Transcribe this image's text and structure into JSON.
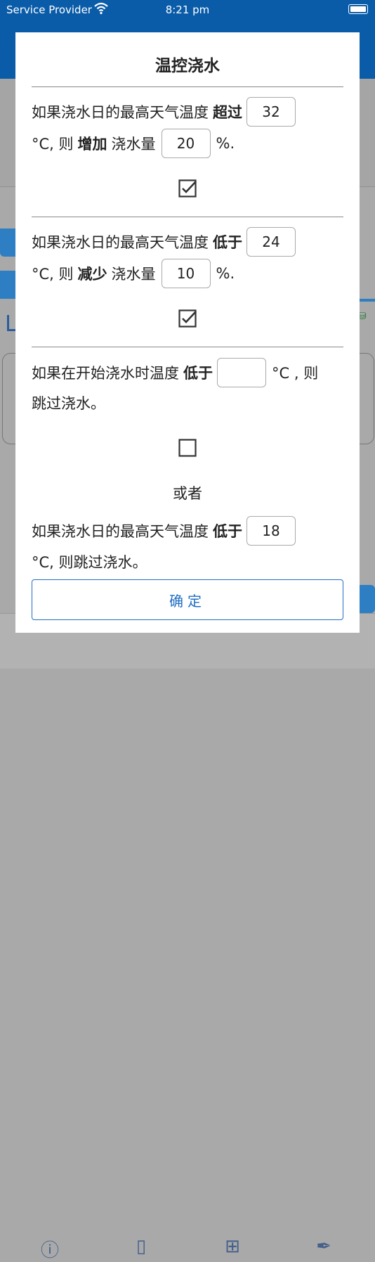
{
  "status_bar": {
    "carrier": "Service Provider",
    "time": "8:21 pm"
  },
  "modal": {
    "title": "温控浇水",
    "rule1": {
      "prefix": "如果浇水日的最高天气温度",
      "keyword": "超过",
      "threshold": "32",
      "unit_then": "°C, 则",
      "action": "增加",
      "mid": "浇水量",
      "percent": "20",
      "suffix": "%.",
      "checked": true
    },
    "rule2": {
      "prefix": "如果浇水日的最高天气温度",
      "keyword": "低于",
      "threshold": "24",
      "unit_then": "°C, 则",
      "action": "减少",
      "mid": "浇水量",
      "percent": "10",
      "suffix": "%.",
      "checked": true
    },
    "rule3": {
      "prefix": "如果在开始浇水时温度",
      "keyword": "低于",
      "threshold": "",
      "unit_then": "°C , 则",
      "line2": "跳过浇水。",
      "checked": false
    },
    "or_label": "或者",
    "rule4": {
      "prefix": "如果浇水日的最高天气温度",
      "keyword": "低于",
      "threshold": "18",
      "line2": "°C, 则跳过浇水。"
    },
    "confirm_label": "确定"
  },
  "colors": {
    "header_blue": "#0a5ca8",
    "accent_blue": "#1f6dc4"
  }
}
